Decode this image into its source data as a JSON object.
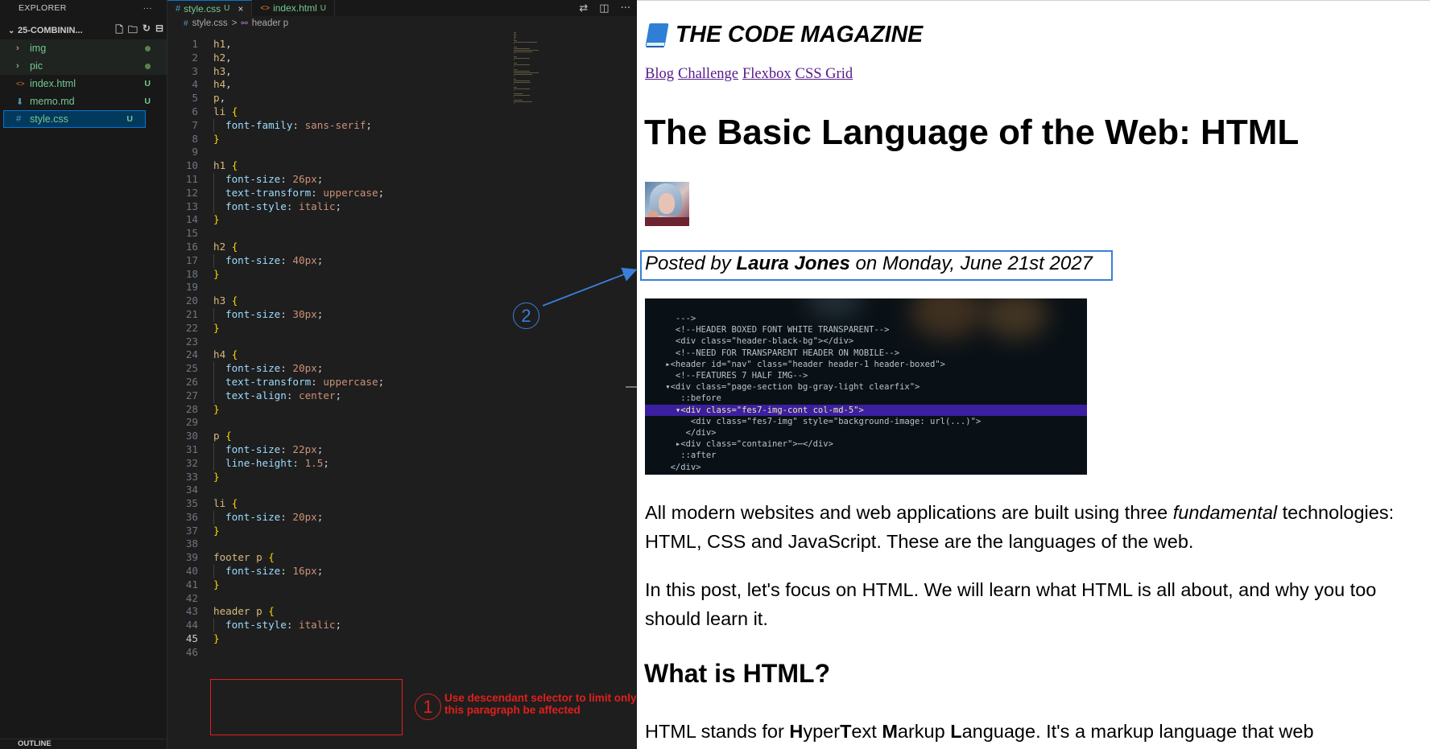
{
  "explorer": {
    "header": "EXPLORER",
    "more": "···",
    "project_name": "25-COMBININ...",
    "items": [
      {
        "name": "img",
        "type": "folder",
        "status": "dot"
      },
      {
        "name": "pic",
        "type": "folder",
        "status": "dot"
      },
      {
        "name": "index.html",
        "type": "html",
        "status": "U"
      },
      {
        "name": "memo.md",
        "type": "md",
        "status": "U"
      },
      {
        "name": "style.css",
        "type": "css",
        "status": "U",
        "selected": true
      }
    ],
    "outline": "OUTLINE"
  },
  "tabs": [
    {
      "label": "style.css",
      "badge": "U",
      "active": true,
      "close": "×"
    },
    {
      "label": "index.html",
      "badge": "U",
      "active": false
    }
  ],
  "breadcrumb": {
    "file": "style.css",
    "separator": ">",
    "symbol": "header p"
  },
  "code_lines": [
    {
      "n": "1",
      "t": "h1,"
    },
    {
      "n": "2",
      "t": "h2,"
    },
    {
      "n": "3",
      "t": "h3,"
    },
    {
      "n": "4",
      "t": "h4,"
    },
    {
      "n": "5",
      "t": "p,"
    },
    {
      "n": "6",
      "t": "li {"
    },
    {
      "n": "7",
      "t": "  font-family: sans-serif;"
    },
    {
      "n": "8",
      "t": "}"
    },
    {
      "n": "9",
      "t": ""
    },
    {
      "n": "10",
      "t": "h1 {"
    },
    {
      "n": "11",
      "t": "  font-size: 26px;"
    },
    {
      "n": "12",
      "t": "  text-transform: uppercase;"
    },
    {
      "n": "13",
      "t": "  font-style: italic;"
    },
    {
      "n": "14",
      "t": "}"
    },
    {
      "n": "15",
      "t": ""
    },
    {
      "n": "16",
      "t": "h2 {"
    },
    {
      "n": "17",
      "t": "  font-size: 40px;"
    },
    {
      "n": "18",
      "t": "}"
    },
    {
      "n": "19",
      "t": ""
    },
    {
      "n": "20",
      "t": "h3 {"
    },
    {
      "n": "21",
      "t": "  font-size: 30px;"
    },
    {
      "n": "22",
      "t": "}"
    },
    {
      "n": "23",
      "t": ""
    },
    {
      "n": "24",
      "t": "h4 {"
    },
    {
      "n": "25",
      "t": "  font-size: 20px;"
    },
    {
      "n": "26",
      "t": "  text-transform: uppercase;"
    },
    {
      "n": "27",
      "t": "  text-align: center;"
    },
    {
      "n": "28",
      "t": "}"
    },
    {
      "n": "29",
      "t": ""
    },
    {
      "n": "30",
      "t": "p {"
    },
    {
      "n": "31",
      "t": "  font-size: 22px;"
    },
    {
      "n": "32",
      "t": "  line-height: 1.5;"
    },
    {
      "n": "33",
      "t": "}"
    },
    {
      "n": "34",
      "t": ""
    },
    {
      "n": "35",
      "t": "li {"
    },
    {
      "n": "36",
      "t": "  font-size: 20px;"
    },
    {
      "n": "37",
      "t": "}"
    },
    {
      "n": "38",
      "t": ""
    },
    {
      "n": "39",
      "t": "footer p {"
    },
    {
      "n": "40",
      "t": "  font-size: 16px;"
    },
    {
      "n": "41",
      "t": "}"
    },
    {
      "n": "42",
      "t": ""
    },
    {
      "n": "43",
      "t": "header p {"
    },
    {
      "n": "44",
      "t": "  font-style: italic;"
    },
    {
      "n": "45",
      "t": "}"
    },
    {
      "n": "46",
      "t": ""
    }
  ],
  "current_line": "45",
  "annotations": {
    "one": {
      "number": "1",
      "text": "Use descendant selector to limit only this paragraph be affected",
      "color": "#e0201c"
    },
    "two": {
      "number": "2",
      "color": "#3a7fd8"
    }
  },
  "page": {
    "site_title": "THE CODE MAGAZINE",
    "nav": [
      "Blog",
      "Challenge",
      "Flexbox",
      "CSS Grid"
    ],
    "article_title": "The Basic Language of the Web: HTML",
    "posted_prefix": "Posted by ",
    "author": "Laura Jones",
    "posted_suffix": " on Monday, June 21st 2027",
    "p1_before": "All modern websites and web applications are built using three ",
    "p1_em": "fundamental",
    "p1_after": " technologies: HTML, CSS and JavaScript. These are the languages of the web.",
    "p2": "In this post, let's focus on HTML. We will learn what HTML is all about, and why you too should learn it.",
    "h2": "What is HTML?",
    "p3_parts": [
      "HTML stands for ",
      "H",
      "yper",
      "T",
      "ext ",
      "M",
      "arkup ",
      "L",
      "anguage. It's a markup language that web"
    ]
  },
  "code_image_lines": [
    {
      "g": "      --->",
      "hl": false
    },
    {
      "g": "      <!--HEADER BOXED FONT WHITE TRANSPARENT-->",
      "hl": false
    },
    {
      "g": "      <div class=\"header-black-bg\"></div>",
      "hl": false
    },
    {
      "g": "      <!--NEED FOR TRANSPARENT HEADER ON MOBILE-->",
      "hl": false
    },
    {
      "g": "    ▸<header id=\"nav\" class=\"header header-1 header-boxed\">",
      "hl": false
    },
    {
      "g": "      <!--FEATURES 7 HALF IMG-->",
      "hl": false
    },
    {
      "g": "    ▾<div class=\"page-section bg-gray-light clearfix\">",
      "hl": false
    },
    {
      "g": "       ::before",
      "hl": false
    },
    {
      "g": "      ▾<div class=\"fes7-img-cont col-md-5\">",
      "hl": true
    },
    {
      "g": "         <div class=\"fes7-img\" style=\"background-image: url(...)\">",
      "hl": false
    },
    {
      "g": "        </div>",
      "hl": false
    },
    {
      "g": "      ▸<div class=\"container\">⋯</div>",
      "hl": false
    },
    {
      "g": "       ::after",
      "hl": false
    },
    {
      "g": "     </div>",
      "hl": false
    }
  ],
  "colors": {
    "editor_bg": "#1e1e1e",
    "sidebar_bg": "#181818",
    "selector": "#d7ba7d",
    "property": "#9cdcfe",
    "value": "#ce9178",
    "brace": "#ffd700",
    "link": "#551a8b",
    "git_untracked": "#73c991"
  }
}
